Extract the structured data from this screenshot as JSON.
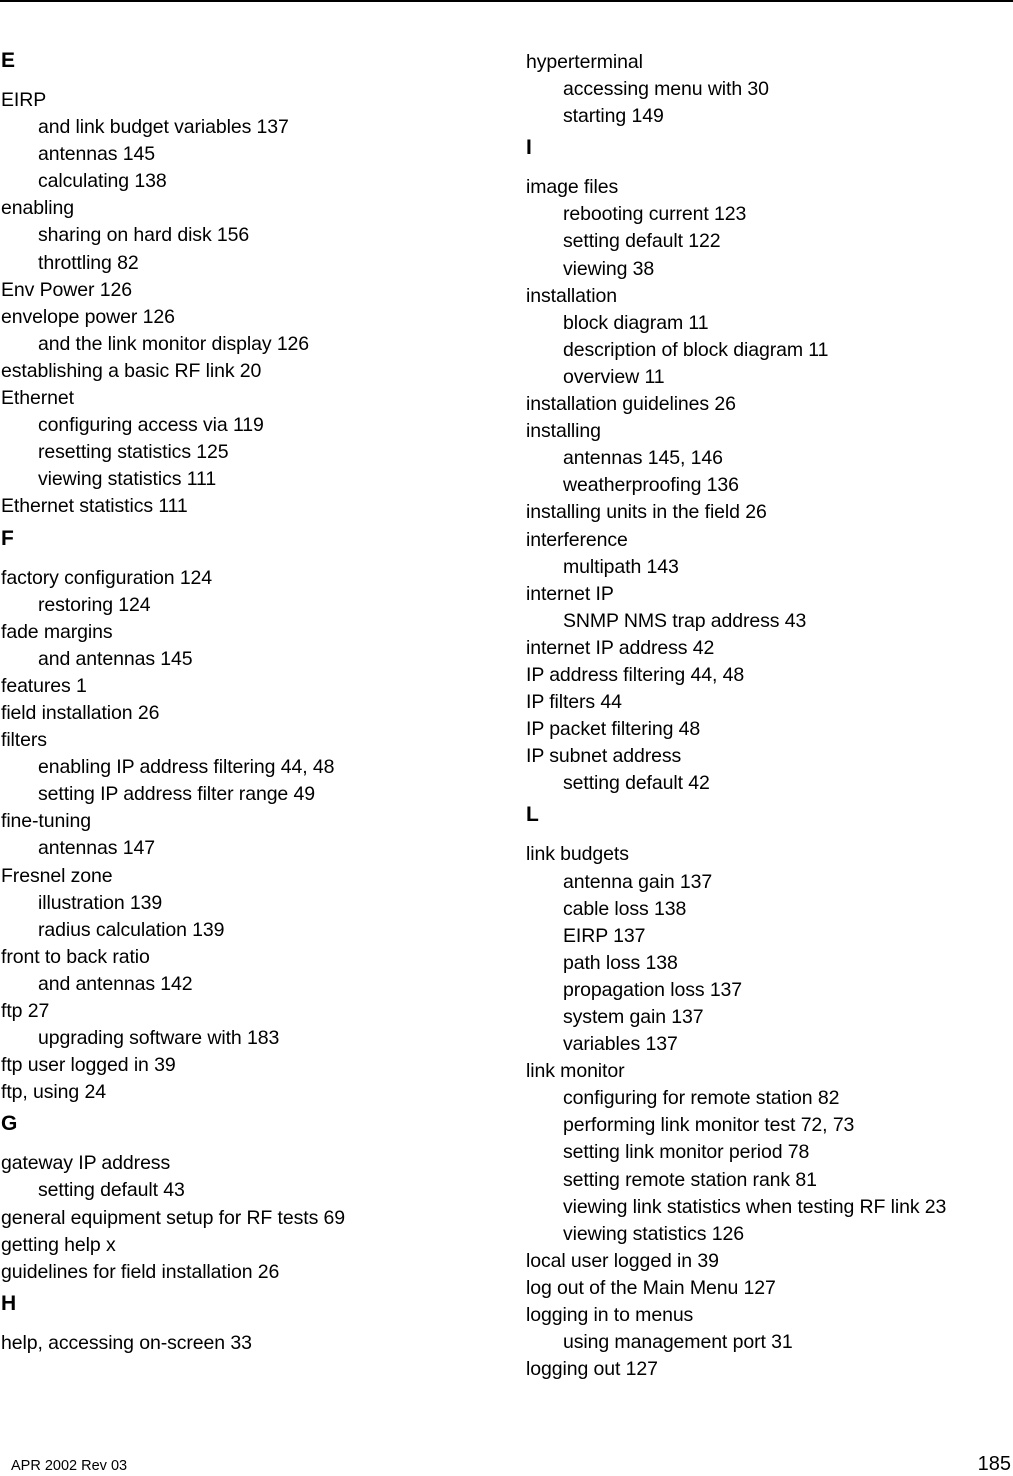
{
  "page": {
    "footer_left": "APR 2002 Rev 03",
    "page_number": "185"
  },
  "columns": [
    {
      "sections": [
        {
          "letter": "E",
          "entries": [
            {
              "text": "EIRP",
              "level": 0
            },
            {
              "text": "and link budget variables 137",
              "level": 1
            },
            {
              "text": "antennas 145",
              "level": 1
            },
            {
              "text": "calculating 138",
              "level": 1
            },
            {
              "text": "enabling",
              "level": 0
            },
            {
              "text": "sharing on hard disk 156",
              "level": 1
            },
            {
              "text": "throttling 82",
              "level": 1
            },
            {
              "text": "Env Power 126",
              "level": 0
            },
            {
              "text": "envelope power 126",
              "level": 0
            },
            {
              "text": "and the link monitor display 126",
              "level": 1
            },
            {
              "text": "establishing a basic RF link 20",
              "level": 0
            },
            {
              "text": "Ethernet",
              "level": 0
            },
            {
              "text": "configuring access via 119",
              "level": 1
            },
            {
              "text": "resetting statistics 125",
              "level": 1
            },
            {
              "text": "viewing statistics 111",
              "level": 1
            },
            {
              "text": "Ethernet statistics 111",
              "level": 0
            }
          ]
        },
        {
          "letter": "F",
          "entries": [
            {
              "text": "factory configuration 124",
              "level": 0
            },
            {
              "text": "restoring 124",
              "level": 1
            },
            {
              "text": "fade margins",
              "level": 0
            },
            {
              "text": "and antennas 145",
              "level": 1
            },
            {
              "text": "features 1",
              "level": 0
            },
            {
              "text": "field installation 26",
              "level": 0
            },
            {
              "text": "filters",
              "level": 0
            },
            {
              "text": "enabling IP address filtering 44, 48",
              "level": 1
            },
            {
              "text": "setting IP address filter range 49",
              "level": 1
            },
            {
              "text": "fine-tuning",
              "level": 0
            },
            {
              "text": "antennas 147",
              "level": 1
            },
            {
              "text": "Fresnel zone",
              "level": 0
            },
            {
              "text": "illustration 139",
              "level": 1
            },
            {
              "text": "radius calculation 139",
              "level": 1
            },
            {
              "text": "front to back ratio",
              "level": 0
            },
            {
              "text": "and antennas 142",
              "level": 1
            },
            {
              "text": "ftp 27",
              "level": 0
            },
            {
              "text": "upgrading software with 183",
              "level": 1
            },
            {
              "text": "ftp user logged in 39",
              "level": 0
            },
            {
              "text": "ftp, using 24",
              "level": 0
            }
          ]
        },
        {
          "letter": "G",
          "entries": [
            {
              "text": "gateway IP address",
              "level": 0
            },
            {
              "text": "setting default 43",
              "level": 1
            },
            {
              "text": "general equipment setup for RF tests 69",
              "level": 0
            },
            {
              "text": "getting help x",
              "level": 0
            },
            {
              "text": "guidelines for field installation 26",
              "level": 0
            }
          ]
        },
        {
          "letter": "H",
          "entries": [
            {
              "text": "help, accessing on-screen 33",
              "level": 0
            }
          ]
        }
      ]
    },
    {
      "sections": [
        {
          "letter": "",
          "entries": [
            {
              "text": "hyperterminal",
              "level": 0
            },
            {
              "text": "accessing menu with 30",
              "level": 1
            },
            {
              "text": "starting 149",
              "level": 1
            }
          ]
        },
        {
          "letter": "I",
          "entries": [
            {
              "text": "image files",
              "level": 0
            },
            {
              "text": "rebooting current 123",
              "level": 1
            },
            {
              "text": "setting default 122",
              "level": 1
            },
            {
              "text": "viewing 38",
              "level": 1
            },
            {
              "text": "installation",
              "level": 0
            },
            {
              "text": "block diagram 11",
              "level": 1
            },
            {
              "text": "description of block diagram 11",
              "level": 1
            },
            {
              "text": "overview 11",
              "level": 1
            },
            {
              "text": "installation guidelines 26",
              "level": 0
            },
            {
              "text": "installing",
              "level": 0
            },
            {
              "text": "antennas 145, 146",
              "level": 1
            },
            {
              "text": "weatherproofing 136",
              "level": 1
            },
            {
              "text": "installing units in the field 26",
              "level": 0
            },
            {
              "text": "interference",
              "level": 0
            },
            {
              "text": "multipath 143",
              "level": 1
            },
            {
              "text": "internet IP",
              "level": 0
            },
            {
              "text": "SNMP NMS trap address 43",
              "level": 1
            },
            {
              "text": "internet IP address 42",
              "level": 0
            },
            {
              "text": "IP address filtering 44, 48",
              "level": 0
            },
            {
              "text": "IP filters 44",
              "level": 0
            },
            {
              "text": "IP packet filtering 48",
              "level": 0
            },
            {
              "text": "IP subnet address",
              "level": 0
            },
            {
              "text": "setting default 42",
              "level": 1
            }
          ]
        },
        {
          "letter": "L",
          "entries": [
            {
              "text": "link budgets",
              "level": 0
            },
            {
              "text": "antenna gain 137",
              "level": 1
            },
            {
              "text": "cable loss 138",
              "level": 1
            },
            {
              "text": "EIRP 137",
              "level": 1
            },
            {
              "text": "path loss 138",
              "level": 1
            },
            {
              "text": "propagation loss 137",
              "level": 1
            },
            {
              "text": "system gain 137",
              "level": 1
            },
            {
              "text": "variables 137",
              "level": 1
            },
            {
              "text": "link monitor",
              "level": 0
            },
            {
              "text": "configuring for remote station 82",
              "level": 1
            },
            {
              "text": "performing link monitor test 72, 73",
              "level": 1
            },
            {
              "text": "setting link monitor period 78",
              "level": 1
            },
            {
              "text": "setting remote station rank 81",
              "level": 1
            },
            {
              "text": "viewing link statistics when testing RF link 23",
              "level": 1
            },
            {
              "text": "viewing statistics 126",
              "level": 1
            },
            {
              "text": "local user logged in 39",
              "level": 0
            },
            {
              "text": "log out of the Main Menu 127",
              "level": 0
            },
            {
              "text": "logging in to menus",
              "level": 0
            },
            {
              "text": "using management port 31",
              "level": 1
            },
            {
              "text": "logging out 127",
              "level": 0
            }
          ]
        }
      ]
    }
  ]
}
